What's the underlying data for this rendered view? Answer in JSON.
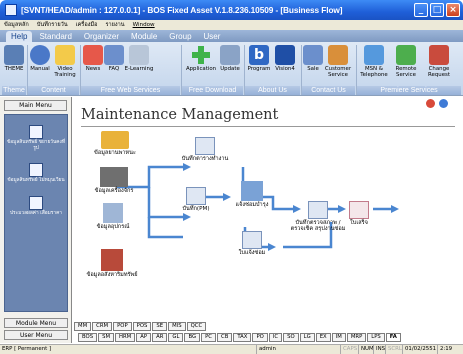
{
  "window": {
    "title": "[SVNT/HEAD/admin : 127.0.0.1] - BOS Fixed Asset V.1.8.236.10509 - [Business Flow]",
    "min_glyph": "_",
    "max_glyph": "□",
    "close_glyph": "×"
  },
  "menubar": [
    "ข้อมูลหลัก",
    "บันทึกรายวัน",
    "เครื่องมือ",
    "รายงาน",
    "Window"
  ],
  "ribbon_tabs": [
    "Help",
    "Standard",
    "Organizer",
    "Module",
    "Group",
    "User"
  ],
  "ribbon_active_tab": "Help",
  "ribbon_items": [
    {
      "label": "THEME",
      "icon": "theme-icon",
      "color": "#5a7fb5"
    },
    {
      "label": "Manual",
      "icon": "help-icon",
      "color": "#4a78c8"
    },
    {
      "label": "Video Training",
      "icon": "video-icon",
      "color": "#f3ca4a"
    },
    {
      "label": "News",
      "icon": "news-icon",
      "color": "#e6584a"
    },
    {
      "label": "FAQ",
      "icon": "faq-icon",
      "color": "#6c8fcc"
    },
    {
      "label": "E-Learning",
      "icon": "elearning-icon",
      "color": "#b8c6d8"
    },
    {
      "label": "Application",
      "icon": "plus-icon",
      "color": "#3fb34a"
    },
    {
      "label": "Update",
      "icon": "update-icon",
      "color": "#8aa3c6"
    },
    {
      "label": "Program",
      "icon": "program-b-icon",
      "color": "#2f68c4"
    },
    {
      "label": "Vision4",
      "icon": "vision-icon",
      "color": "#1f4fa6"
    },
    {
      "label": "Sale",
      "icon": "sale-icon",
      "color": "#6b8fcc"
    },
    {
      "label": "Customer Service",
      "icon": "customer-service-icon",
      "color": "#d98f3a"
    },
    {
      "label": "MSN & Telephone",
      "icon": "msn-icon",
      "color": "#5599dd"
    },
    {
      "label": "Remote Service",
      "icon": "remote-icon",
      "color": "#4dae4d"
    },
    {
      "label": "Change Request",
      "icon": "change-request-icon",
      "color": "#c94b3d"
    }
  ],
  "ribbon_groups": [
    "Theme",
    "Content",
    "Free Web Services",
    "Free Download",
    "About Us",
    "Contact Us",
    "Premiere Services"
  ],
  "left_panel": {
    "header": "Main Menu",
    "entries": [
      "ข้อมูลสินทรัพย์ ขยายวันคงที่รูป",
      "ข้อมูลสินทรัพย์ ไม่หมุนเวียน",
      "ประมวลผลค่า เสื่อมราคา"
    ],
    "module_menu": "Module Menu",
    "user_menu": "User Menu"
  },
  "main": {
    "title": "Maintenance Management",
    "nodes": [
      "ข้อมูลยานพาหนะ",
      "ข้อมูลเครื่องจักร",
      "ข้อมูลอุปกรณ์",
      "ข้อมูลอสังหาริมทรัพย์",
      "บันทึกตารางทำงาน",
      "บันทึก(PM)",
      "แจ้งซ่อมบำรุง",
      "ใบแจ้งซ่อม",
      "บันทึกตรวจสภาพ /ตรวจเช็ค สรุปงานซ่อม",
      "ใบเสร็จ"
    ]
  },
  "tabs_row1": [
    "MM",
    "CRM",
    "POP",
    "POS",
    "SE",
    "MIS",
    "QCC"
  ],
  "tabs_row2": [
    "BOS",
    "SM",
    "HRM",
    "AP",
    "AR",
    "GL",
    "BG",
    "PC",
    "CB",
    "TAX",
    "PO",
    "IC",
    "SO",
    "LG",
    "EX",
    "IM",
    "MRP",
    "LPS",
    "FA"
  ],
  "tabs_row2_active": "FA",
  "status": {
    "mode": "ERP [ Permanent ]",
    "user": "admin",
    "caps": "CAPS",
    "num": "NUM",
    "ins": "INS",
    "scrl": "SCRL",
    "date": "01/02/2551",
    "time": "2:19"
  }
}
